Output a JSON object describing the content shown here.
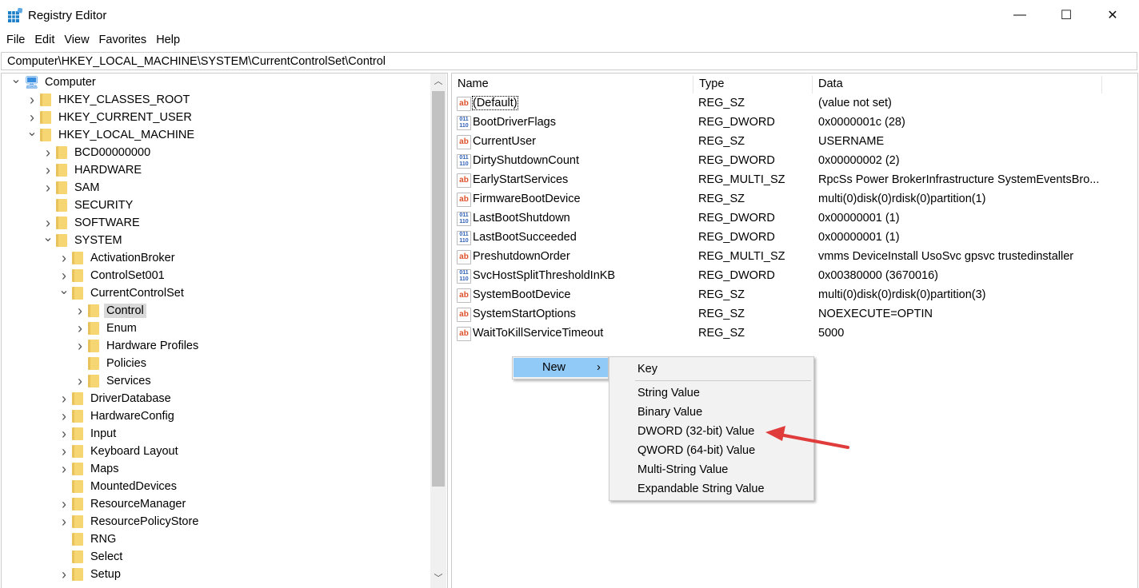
{
  "window": {
    "title": "Registry Editor",
    "minimize": "—",
    "maximize": "☐",
    "close": "✕"
  },
  "menu": [
    "File",
    "Edit",
    "View",
    "Favorites",
    "Help"
  ],
  "address": "Computer\\HKEY_LOCAL_MACHINE\\SYSTEM\\CurrentControlSet\\Control",
  "tree": [
    {
      "label": "Computer",
      "level": 0,
      "state": "expanded",
      "icon": "computer"
    },
    {
      "label": "HKEY_CLASSES_ROOT",
      "level": 1,
      "state": "collapsed"
    },
    {
      "label": "HKEY_CURRENT_USER",
      "level": 1,
      "state": "collapsed"
    },
    {
      "label": "HKEY_LOCAL_MACHINE",
      "level": 1,
      "state": "expanded"
    },
    {
      "label": "BCD00000000",
      "level": 2,
      "state": "collapsed"
    },
    {
      "label": "HARDWARE",
      "level": 2,
      "state": "collapsed"
    },
    {
      "label": "SAM",
      "level": 2,
      "state": "collapsed"
    },
    {
      "label": "SECURITY",
      "level": 2,
      "state": "none"
    },
    {
      "label": "SOFTWARE",
      "level": 2,
      "state": "collapsed"
    },
    {
      "label": "SYSTEM",
      "level": 2,
      "state": "expanded"
    },
    {
      "label": "ActivationBroker",
      "level": 3,
      "state": "collapsed"
    },
    {
      "label": "ControlSet001",
      "level": 3,
      "state": "collapsed"
    },
    {
      "label": "CurrentControlSet",
      "level": 3,
      "state": "expanded"
    },
    {
      "label": "Control",
      "level": 4,
      "state": "collapsed",
      "selected": true
    },
    {
      "label": "Enum",
      "level": 4,
      "state": "collapsed"
    },
    {
      "label": "Hardware Profiles",
      "level": 4,
      "state": "collapsed"
    },
    {
      "label": "Policies",
      "level": 4,
      "state": "none"
    },
    {
      "label": "Services",
      "level": 4,
      "state": "collapsed"
    },
    {
      "label": "DriverDatabase",
      "level": 3,
      "state": "collapsed"
    },
    {
      "label": "HardwareConfig",
      "level": 3,
      "state": "collapsed"
    },
    {
      "label": "Input",
      "level": 3,
      "state": "collapsed"
    },
    {
      "label": "Keyboard Layout",
      "level": 3,
      "state": "collapsed"
    },
    {
      "label": "Maps",
      "level": 3,
      "state": "collapsed"
    },
    {
      "label": "MountedDevices",
      "level": 3,
      "state": "none"
    },
    {
      "label": "ResourceManager",
      "level": 3,
      "state": "collapsed"
    },
    {
      "label": "ResourcePolicyStore",
      "level": 3,
      "state": "collapsed"
    },
    {
      "label": "RNG",
      "level": 3,
      "state": "none"
    },
    {
      "label": "Select",
      "level": 3,
      "state": "none"
    },
    {
      "label": "Setup",
      "level": 3,
      "state": "collapsed"
    }
  ],
  "columns": {
    "name": "Name",
    "type": "Type",
    "data": "Data"
  },
  "values": [
    {
      "name": "(Default)",
      "type": "REG_SZ",
      "data": "(value not set)",
      "icon": "string"
    },
    {
      "name": "BootDriverFlags",
      "type": "REG_DWORD",
      "data": "0x0000001c (28)",
      "icon": "binary"
    },
    {
      "name": "CurrentUser",
      "type": "REG_SZ",
      "data": "USERNAME",
      "icon": "string"
    },
    {
      "name": "DirtyShutdownCount",
      "type": "REG_DWORD",
      "data": "0x00000002 (2)",
      "icon": "binary"
    },
    {
      "name": "EarlyStartServices",
      "type": "REG_MULTI_SZ",
      "data": "RpcSs Power BrokerInfrastructure SystemEventsBro...",
      "icon": "string"
    },
    {
      "name": "FirmwareBootDevice",
      "type": "REG_SZ",
      "data": "multi(0)disk(0)rdisk(0)partition(1)",
      "icon": "string"
    },
    {
      "name": "LastBootShutdown",
      "type": "REG_DWORD",
      "data": "0x00000001 (1)",
      "icon": "binary"
    },
    {
      "name": "LastBootSucceeded",
      "type": "REG_DWORD",
      "data": "0x00000001 (1)",
      "icon": "binary"
    },
    {
      "name": "PreshutdownOrder",
      "type": "REG_MULTI_SZ",
      "data": "vmms DeviceInstall UsoSvc gpsvc trustedinstaller",
      "icon": "string"
    },
    {
      "name": "SvcHostSplitThresholdInKB",
      "type": "REG_DWORD",
      "data": "0x00380000 (3670016)",
      "icon": "binary"
    },
    {
      "name": "SystemBootDevice",
      "type": "REG_SZ",
      "data": "multi(0)disk(0)rdisk(0)partition(3)",
      "icon": "string"
    },
    {
      "name": "SystemStartOptions",
      "type": "REG_SZ",
      "data": " NOEXECUTE=OPTIN",
      "icon": "string"
    },
    {
      "name": "WaitToKillServiceTimeout",
      "type": "REG_SZ",
      "data": "5000",
      "icon": "string"
    }
  ],
  "context_menu": {
    "new_label": "New",
    "arrow": "›",
    "submenu": [
      "Key",
      "String Value",
      "Binary Value",
      "DWORD (32-bit) Value",
      "QWORD (64-bit) Value",
      "Multi-String Value",
      "Expandable String Value"
    ]
  },
  "colors": {
    "menu_highlight": "#91c9f7",
    "annotation_arrow": "#e03c3c"
  }
}
